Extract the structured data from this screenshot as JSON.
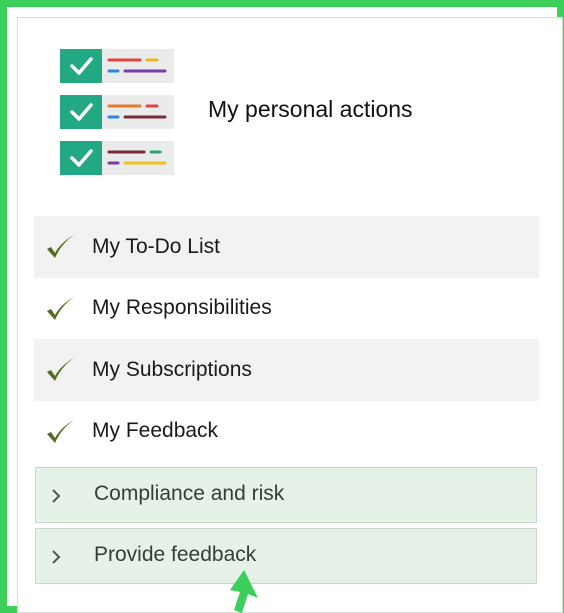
{
  "header": {
    "title": "My personal actions",
    "logo_icon": "checklist-icon"
  },
  "menu": {
    "items": [
      {
        "label": "My To-Do List",
        "icon": "checkmark-icon"
      },
      {
        "label": "My Responsibilities",
        "icon": "checkmark-icon"
      },
      {
        "label": "My Subscriptions",
        "icon": "checkmark-icon"
      },
      {
        "label": "My Feedback",
        "icon": "checkmark-icon"
      }
    ]
  },
  "expanders": [
    {
      "label": "Compliance and risk",
      "icon": "chevron-right-icon",
      "expanded": false
    },
    {
      "label": "Provide feedback",
      "icon": "chevron-right-icon",
      "expanded": false
    }
  ],
  "annotation": {
    "icon": "arrow-up-icon"
  },
  "colors": {
    "frame_border": "#3ccf5b",
    "logo_check_bg": "#23a884",
    "checkmark": "#4f6d1f",
    "expander_bg": "#e6f2e7",
    "row_shade": "#f2f2f2"
  }
}
